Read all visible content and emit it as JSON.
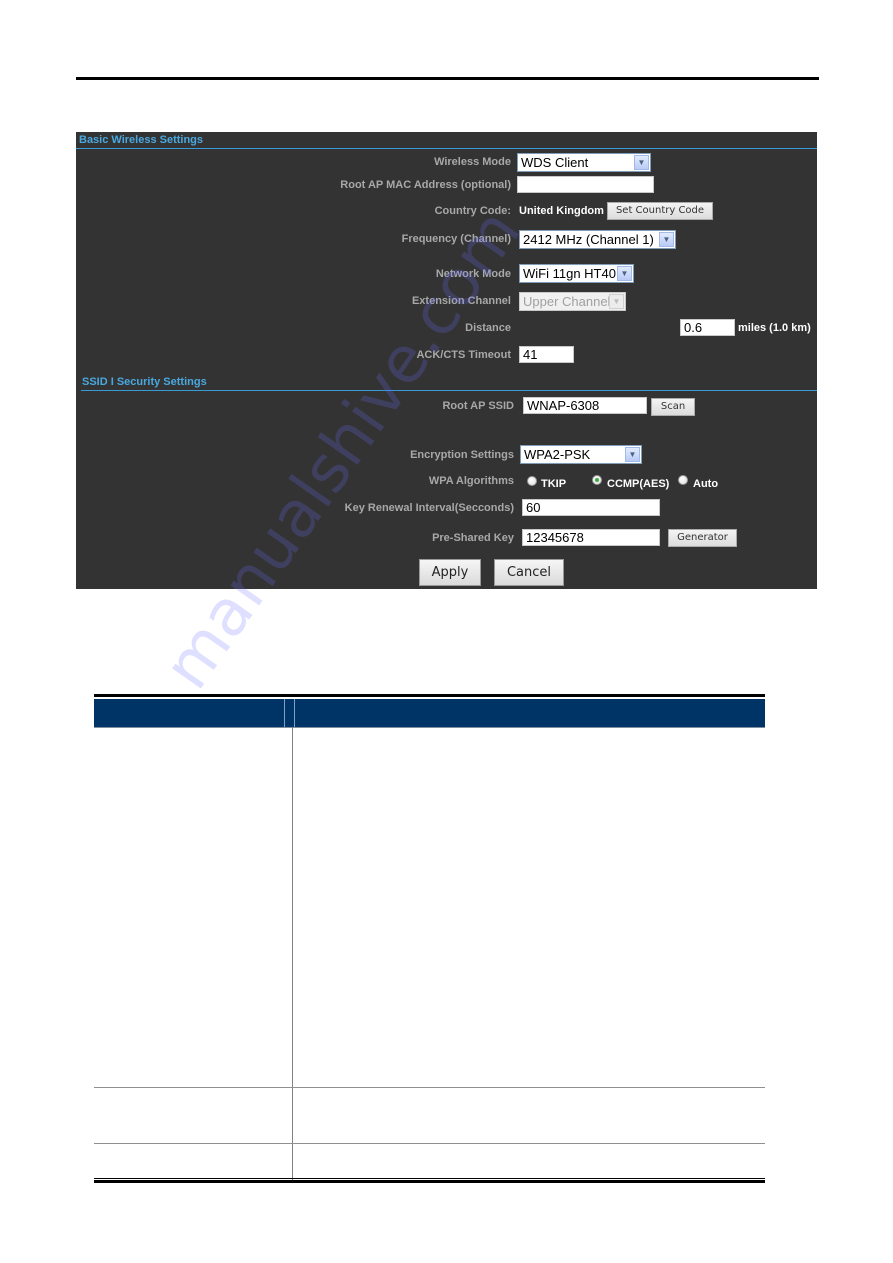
{
  "basic_section": {
    "title": "Basic Wireless Settings",
    "wireless_mode": {
      "label": "Wireless Mode",
      "value": "WDS Client"
    },
    "root_ap_mac": {
      "label": "Root AP MAC Address (optional)",
      "value": ""
    },
    "country_code": {
      "label": "Country Code:",
      "value": "United Kingdom",
      "button": "Set Country Code"
    },
    "frequency": {
      "label": "Frequency (Channel)",
      "value": "2412 MHz (Channel 1)"
    },
    "network_mode": {
      "label": "Network Mode",
      "value": "WiFi 11gn HT40"
    },
    "extension_channel": {
      "label": "Extension Channel",
      "value": "Upper Channel"
    },
    "distance": {
      "label": "Distance",
      "value": "0.6",
      "unit": "miles (1.0 km)"
    },
    "ack_timeout": {
      "label": "ACK/CTS Timeout",
      "value": "41"
    }
  },
  "security_section": {
    "title": "SSID I Security Settings",
    "root_ap_ssid": {
      "label": "Root AP SSID",
      "value": "WNAP-6308",
      "button": "Scan"
    },
    "encryption": {
      "label": "Encryption Settings",
      "value": "WPA2-PSK"
    },
    "wpa_algorithms": {
      "label": "WPA Algorithms",
      "options": [
        {
          "label": "TKIP",
          "checked": false
        },
        {
          "label": "CCMP(AES)",
          "checked": true
        },
        {
          "label": "Auto",
          "checked": false
        }
      ]
    },
    "key_renewal": {
      "label": "Key Renewal Interval(Secconds)",
      "value": "60"
    },
    "psk": {
      "label": "Pre-Shared Key",
      "value": "12345678",
      "button": "Generator"
    }
  },
  "actions": {
    "apply": "Apply",
    "cancel": "Cancel"
  },
  "icons": {
    "dropdown_arrow": "▼"
  },
  "watermark": "manualshive.com",
  "colors": {
    "panel_bg": "#333333",
    "section_title": "#4aa8e0",
    "table_header": "#003366"
  }
}
